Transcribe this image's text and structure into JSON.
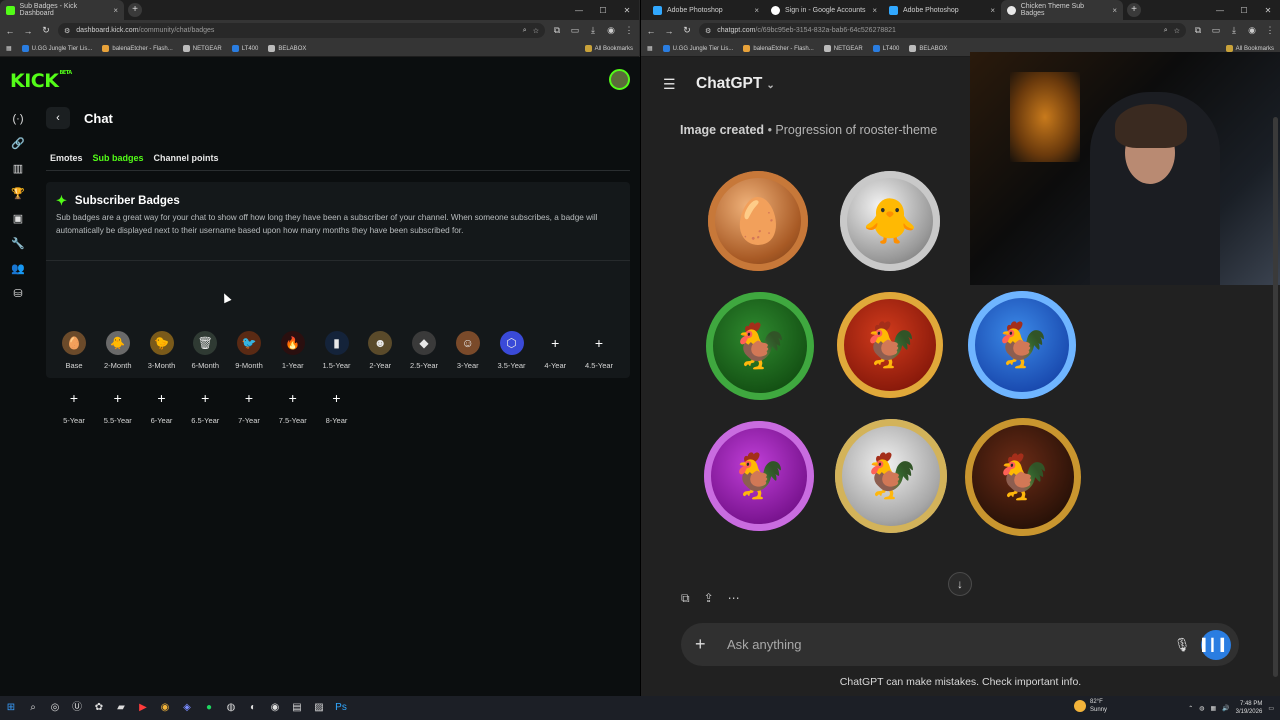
{
  "left_browser": {
    "tabs": [
      {
        "title": "Sub Badges - Kick Dashboard",
        "favicon_color": "#53fc18"
      }
    ],
    "url": "dashboard.kick.com",
    "url_path": "/community/chat/badges",
    "bookmarks": [
      "U.GG Jungle Tier Lis...",
      "balenaEtcher - Flash...",
      "NETGEAR",
      "LT400",
      "BELABOX"
    ],
    "all_bookmarks": "All Bookmarks"
  },
  "kick": {
    "logo": "KICK",
    "logo_tag": "BETA",
    "page_title": "Chat",
    "subtabs": [
      "Emotes",
      "Sub badges",
      "Channel points"
    ],
    "active_subtab": "Sub badges",
    "card_title": "Subscriber Badges",
    "card_description": "Sub badges are a great way for your chat to show off how long they have been a subscriber of your channel. When someone subscribes, a badge will automatically be displayed next to their username based upon how many months they have been subscribed for.",
    "badges_row1": [
      {
        "label": "Base",
        "icon": "egg-icon",
        "glyph": "🥚",
        "color": "#6b4a2a",
        "filled": true
      },
      {
        "label": "2-Month",
        "icon": "chick-icon",
        "glyph": "🐥",
        "color": "#6a6a6a",
        "filled": true
      },
      {
        "label": "3-Month",
        "icon": "chick-nest-icon",
        "glyph": "🐤",
        "color": "#7a5a1a",
        "filled": true
      },
      {
        "label": "6-Month",
        "icon": "trash-can-icon",
        "glyph": "🗑",
        "color": "#2f3a33",
        "filled": true
      },
      {
        "label": "9-Month",
        "icon": "fire-bird-icon",
        "glyph": "🐦",
        "color": "#5a2a14",
        "filled": true
      },
      {
        "label": "1-Year",
        "icon": "flame-icon",
        "glyph": "🔥",
        "color": "#2a0f0f",
        "filled": true
      },
      {
        "label": "1.5-Year",
        "icon": "bar-chart-icon",
        "glyph": "▮",
        "color": "#14233a",
        "filled": true
      },
      {
        "label": "2-Year",
        "icon": "mask-icon",
        "glyph": "☻",
        "color": "#5a4a2a",
        "filled": true
      },
      {
        "label": "2.5-Year",
        "icon": "ethereum-icon",
        "glyph": "◆",
        "color": "#3a3a3a",
        "filled": true
      },
      {
        "label": "3-Year",
        "icon": "portrait-icon",
        "glyph": "☺",
        "color": "#7a4a2a",
        "filled": true
      },
      {
        "label": "3.5-Year",
        "icon": "hexagon-icon",
        "glyph": "⬡",
        "color": "#3a4ad8",
        "filled": true
      },
      {
        "label": "4-Year",
        "icon": "plus-icon",
        "glyph": "+",
        "filled": false
      },
      {
        "label": "4.5-Year",
        "icon": "plus-icon",
        "glyph": "+",
        "filled": false
      }
    ],
    "badges_row2": [
      {
        "label": "5-Year"
      },
      {
        "label": "5.5-Year"
      },
      {
        "label": "6-Year"
      },
      {
        "label": "6.5-Year"
      },
      {
        "label": "7-Year"
      },
      {
        "label": "7.5-Year"
      },
      {
        "label": "8-Year"
      }
    ],
    "accent": "#53fc18"
  },
  "right_browser": {
    "tabs": [
      {
        "title": "Adobe Photoshop",
        "favicon_color": "#31a8ff"
      },
      {
        "title": "Sign in - Google Accounts",
        "favicon_color": "#ffffff"
      },
      {
        "title": "Adobe Photoshop",
        "favicon_color": "#31a8ff"
      },
      {
        "title": "Chicken Theme Sub Badges",
        "favicon_color": "#e8e8e8"
      }
    ],
    "url": "chatgpt.com",
    "url_path": "/c/69bc95eb-3154-832a-bab6-64c526278821",
    "bookmarks": [
      "U.GG Jungle Tier Lis...",
      "balenaEtcher - Flash...",
      "NETGEAR",
      "LT400",
      "BELABOX"
    ],
    "all_bookmarks": "All Bookmarks"
  },
  "chatgpt": {
    "title": "ChatGPT",
    "caption_bold": "Image created",
    "caption_rest": "• Progression of rooster-theme",
    "medals": [
      {
        "name": "egg-medal",
        "glyph": "🥚"
      },
      {
        "name": "chick-medal",
        "glyph": "🐥"
      },
      {
        "name": "green-rooster-medal",
        "glyph": "🐓"
      },
      {
        "name": "red-rooster-medal",
        "glyph": "🐓"
      },
      {
        "name": "blue-rooster-medal",
        "glyph": "🐓"
      },
      {
        "name": "purple-rooster-medal",
        "glyph": "🐓"
      },
      {
        "name": "silver-rooster-medal",
        "glyph": "🐓"
      },
      {
        "name": "dark-rooster-medal",
        "glyph": "🐓"
      }
    ],
    "composer_placeholder": "Ask anything",
    "disclaimer": "ChatGPT can make mistakes. Check important info."
  },
  "taskbar": {
    "weather_temp": "82°F",
    "weather_desc": "Sunny",
    "time": "7:48 PM",
    "date": "3/19/2026"
  }
}
